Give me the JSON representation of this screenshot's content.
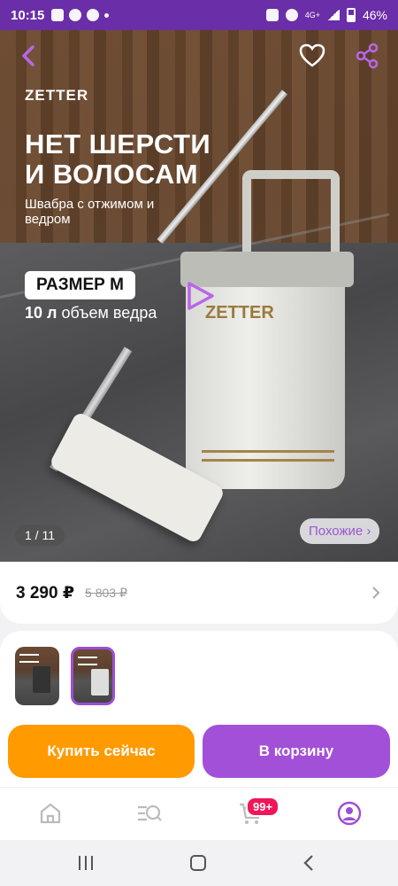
{
  "status_bar": {
    "time": "10:15",
    "network": "4G+",
    "battery": "46%"
  },
  "hero": {
    "brand": "ZETTER",
    "headline_line1": "НЕТ ШЕРСТИ",
    "headline_line2": "И ВОЛОСАМ",
    "subtitle": "Швабра с отжимом и ведром",
    "size_badge": "РАЗМЕР М",
    "volume_value": "10 л",
    "volume_label": "объем ведра",
    "bucket_logo": "ZETTER",
    "image_counter": "1 / 11",
    "similar_label": "Похожие ›"
  },
  "price": {
    "current": "3 290 ₽",
    "old": "5 803 ₽"
  },
  "actions": {
    "buy_now": "Купить сейчас",
    "to_cart": "В корзину"
  },
  "tab_bar": {
    "cart_badge": "99+"
  },
  "colors": {
    "accent": "#a350d9",
    "buy_now": "#ff9a00",
    "status_bar": "#6a2ea8",
    "badge": "#f0165a"
  },
  "icons": [
    "back-arrow-icon",
    "heart-icon",
    "share-icon",
    "play-icon",
    "chevron-right-icon",
    "home-icon",
    "catalog-search-icon",
    "cart-icon",
    "profile-icon"
  ]
}
